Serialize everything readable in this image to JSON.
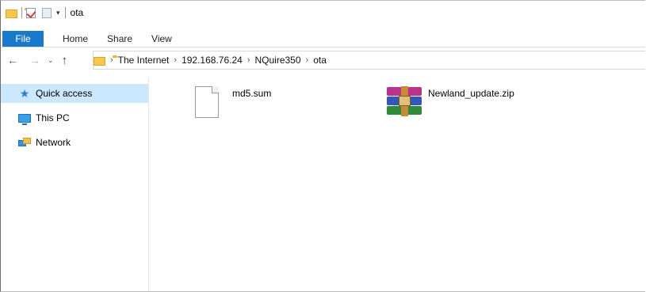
{
  "window": {
    "title": "ota"
  },
  "quick_access_toolbar": {
    "items": [
      "folder-icon",
      "properties-check-icon",
      "new-folder-icon",
      "customize-dropdown"
    ]
  },
  "ribbon": {
    "tabs": [
      {
        "label": "File",
        "active": true
      },
      {
        "label": "Home"
      },
      {
        "label": "Share"
      },
      {
        "label": "View"
      }
    ]
  },
  "navigation": {
    "back": "←",
    "forward": "→",
    "recent": "⌄",
    "up": "↑"
  },
  "address_bar": {
    "breadcrumbs": [
      "The Internet",
      "192.168.76.24",
      "NQuire350",
      "ota"
    ]
  },
  "nav_pane": {
    "items": [
      {
        "label": "Quick access",
        "icon": "star-icon",
        "selected": true
      },
      {
        "label": "This PC",
        "icon": "computer-icon"
      },
      {
        "label": "Network",
        "icon": "network-icon"
      }
    ]
  },
  "files": [
    {
      "name": "md5.sum",
      "icon": "generic-file-icon"
    },
    {
      "name": "Newland_update.zip",
      "icon": "winrar-archive-icon"
    }
  ],
  "colors": {
    "file_tab": "#1979ca",
    "selection": "#cce8ff"
  }
}
